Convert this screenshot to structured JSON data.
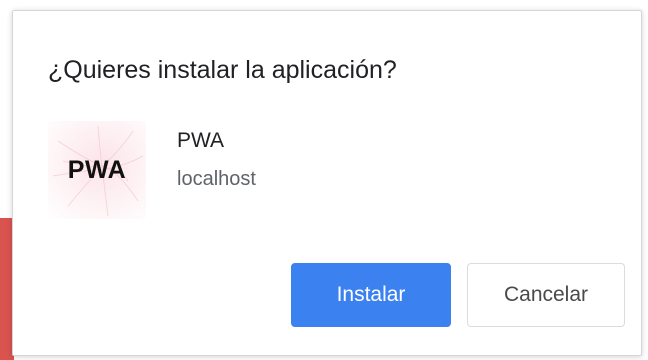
{
  "dialog": {
    "title": "¿Quieres instalar la aplicación?",
    "app": {
      "icon_text": "PWA",
      "name": "PWA",
      "origin": "localhost"
    },
    "buttons": {
      "install_label": "Instalar",
      "cancel_label": "Cancelar"
    }
  },
  "colors": {
    "install_button": "#3b82f0",
    "page_accent": "#d9534f"
  },
  "icons": {
    "app_icon": "pwa-app-icon"
  }
}
